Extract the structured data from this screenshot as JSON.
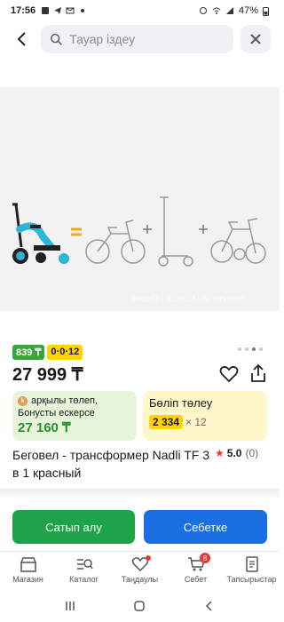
{
  "status_bar": {
    "time": "17:56",
    "battery": "47%"
  },
  "search": {
    "placeholder": "Тауар іздеу"
  },
  "gallery": {
    "watermark": "shop67...s...m...f...h...ms.com",
    "dot_count": 4,
    "active_dot": 2
  },
  "badges": {
    "green": "839 ₸",
    "yellow": "0·0·12"
  },
  "price": "27 999 ₸",
  "bonus_card": {
    "line1": "арқылы төлеп,",
    "line2": "Бонусты ескерсе",
    "price": "27 160 ₸"
  },
  "installment_card": {
    "title": "Бөліп төлеу",
    "monthly": "2 334",
    "months": "× 12"
  },
  "product": {
    "title": "Беговел - трансформер Nadli TF 3 в 1 красный"
  },
  "rating": {
    "star": "★",
    "value": "5.0",
    "count": "(0)"
  },
  "actions": {
    "buy": "Сатып алу",
    "cart": "Себетке"
  },
  "nav": {
    "items": [
      {
        "label": "Магазин",
        "icon": "store-icon"
      },
      {
        "label": "Каталог",
        "icon": "catalog-icon"
      },
      {
        "label": "Таңдаулы",
        "icon": "heart-icon"
      },
      {
        "label": "Себет",
        "icon": "cart-icon",
        "badge": "8"
      },
      {
        "label": "Тапсырыстар",
        "icon": "orders-icon"
      }
    ]
  },
  "colors": {
    "green": "#1fa349",
    "blue": "#1a6fe3",
    "yellow": "#ffd400",
    "red": "#e53935"
  }
}
